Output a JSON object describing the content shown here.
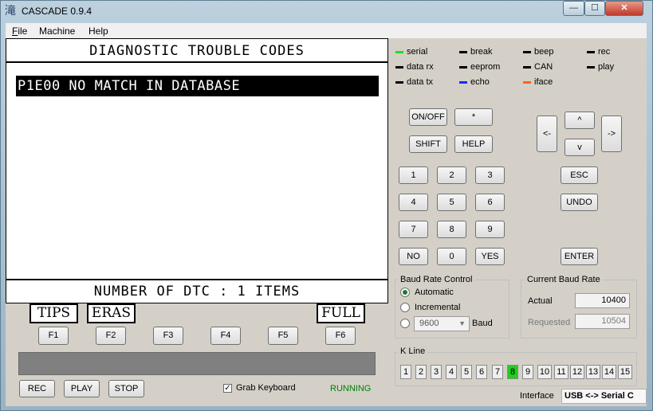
{
  "window": {
    "title": "CASCADE 0.9.4",
    "app_icon_glyph": "滝",
    "min_glyph": "—",
    "max_glyph": "☐",
    "close_glyph": "✕"
  },
  "menu": [
    {
      "label": "File",
      "mnemonic": "F",
      "rest": "ile"
    },
    {
      "label": "Machine"
    },
    {
      "label": "Help"
    }
  ],
  "lcd": {
    "header": "DIAGNOSTIC TROUBLE CODES",
    "selected_line": "P1E00 NO MATCH IN DATABASE",
    "footer": "NUMBER OF DTC  :  1 ITEMS"
  },
  "softkeys": {
    "f1": "TIPS",
    "f2": "ERAS",
    "f6": "FULL"
  },
  "fkeys": [
    "F1",
    "F2",
    "F3",
    "F4",
    "F5",
    "F6"
  ],
  "controls": {
    "rec": "REC",
    "play": "PLAY",
    "stop": "STOP",
    "grab_keyboard": "Grab Keyboard",
    "grab_checked": true,
    "status": "RUNNING"
  },
  "indicators": [
    {
      "label": "serial",
      "color": "#22dd22"
    },
    {
      "label": "break",
      "color": "#000000"
    },
    {
      "label": "beep",
      "color": "#000000"
    },
    {
      "label": "rec",
      "color": "#000000"
    },
    {
      "label": "data rx",
      "color": "#000000"
    },
    {
      "label": "eeprom",
      "color": "#000000"
    },
    {
      "label": "CAN",
      "color": "#000000"
    },
    {
      "label": "play",
      "color": "#000000"
    },
    {
      "label": "data tx",
      "color": "#000000"
    },
    {
      "label": "echo",
      "color": "#1030ff"
    },
    {
      "label": "iface",
      "color": "#ff6600"
    }
  ],
  "keypad": {
    "onoff": "ON/OFF",
    "star": "*",
    "shift": "SHIFT",
    "help": "HELP",
    "left": "<-",
    "up": "^",
    "down": "v",
    "right": "->",
    "digits": [
      "1",
      "2",
      "3",
      "4",
      "5",
      "6",
      "7",
      "8",
      "9",
      "0"
    ],
    "no": "NO",
    "yes": "YES",
    "esc": "ESC",
    "undo": "UNDO",
    "enter": "ENTER"
  },
  "baud_control": {
    "title": "Baud Rate Control",
    "automatic": "Automatic",
    "incremental": "Incremental",
    "selected": "automatic",
    "rate_value": "9600",
    "baud_label": "Baud"
  },
  "current_baud": {
    "title": "Current Baud Rate",
    "actual_label": "Actual",
    "actual_value": "10400",
    "requested_label": "Requested",
    "requested_value": "10504"
  },
  "kline": {
    "title": "K Line",
    "lines": [
      "1",
      "2",
      "3",
      "4",
      "5",
      "6",
      "7",
      "8",
      "9",
      "10",
      "11",
      "12",
      "13",
      "14",
      "15"
    ],
    "active": "8"
  },
  "interface": {
    "label": "Interface",
    "value": "USB <-> Serial C"
  },
  "colors": {
    "running": "#008000",
    "kline_active": "#22cc22"
  }
}
